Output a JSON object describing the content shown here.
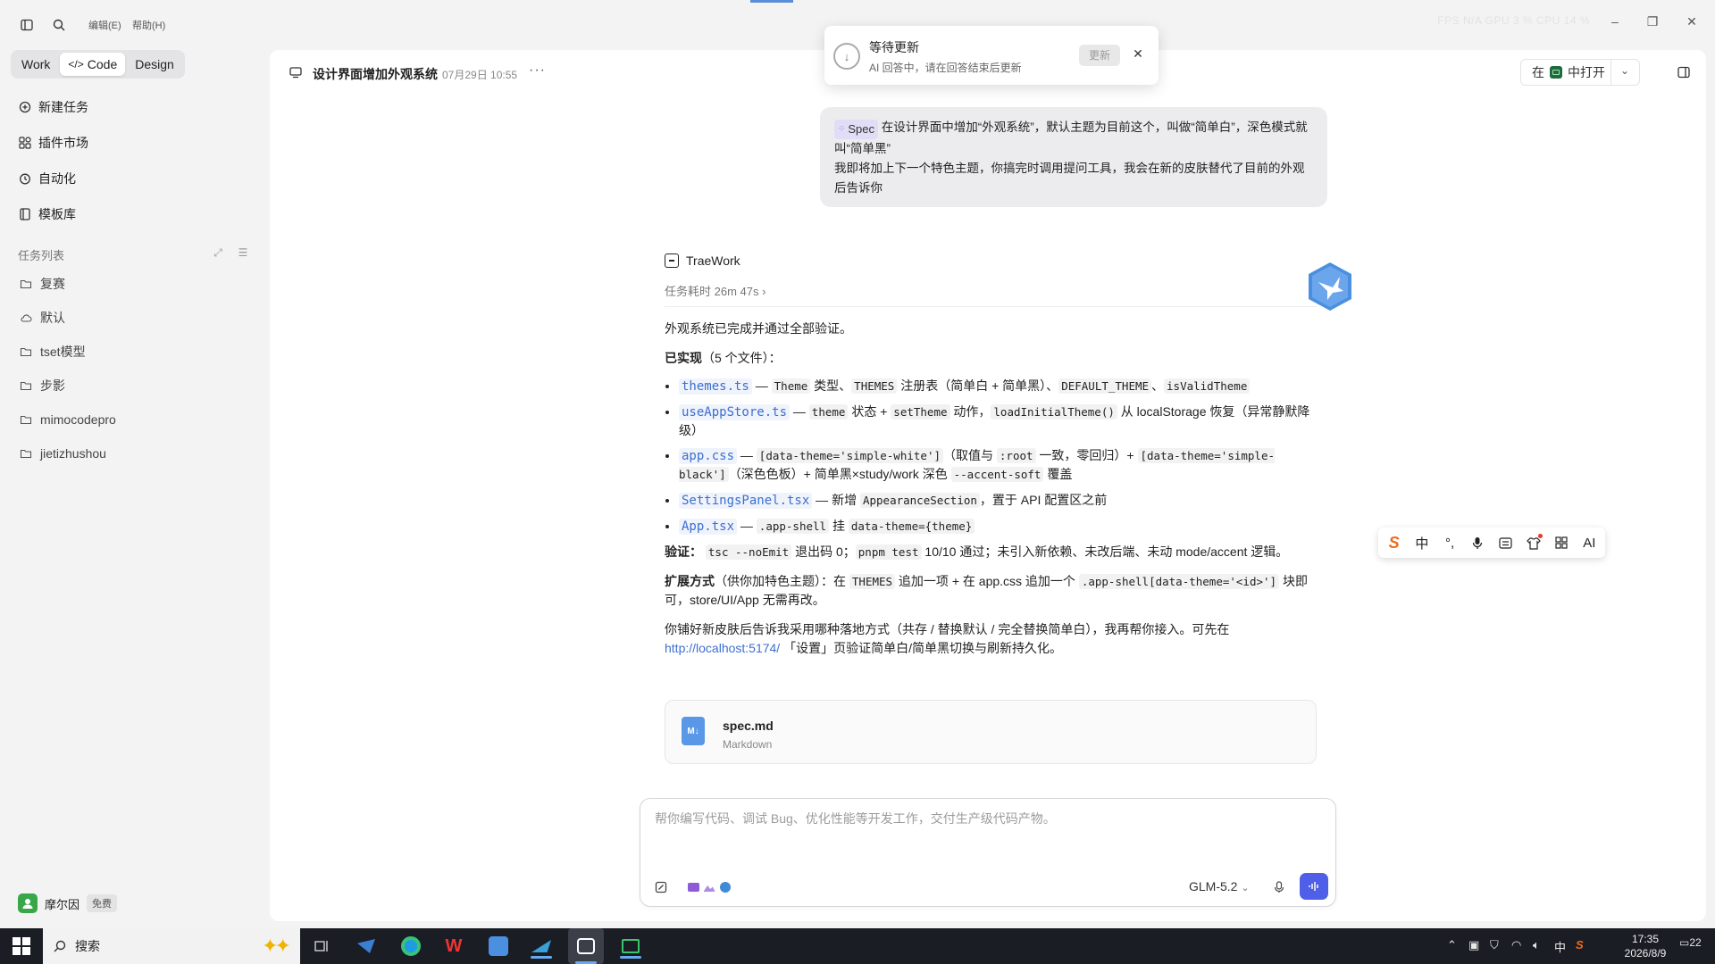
{
  "titlebar": {
    "menu_edit": "编辑(E)",
    "menu_help": "帮助(H)",
    "stats": "FPS N/A   GPU 3 %   CPU 14 %"
  },
  "sidebar": {
    "modes": [
      "Work",
      "Code",
      "Design"
    ],
    "active_mode": "Code",
    "nav": [
      {
        "label": "新建任务",
        "icon": "new-task-icon"
      },
      {
        "label": "插件市场",
        "icon": "plugins-icon"
      },
      {
        "label": "自动化",
        "icon": "clock-icon"
      },
      {
        "label": "模板库",
        "icon": "template-icon"
      }
    ],
    "section_label": "任务列表",
    "folders": [
      {
        "label": "复赛",
        "icon": "folder-icon"
      },
      {
        "label": "默认",
        "icon": "cloud-icon"
      },
      {
        "label": "tset模型",
        "icon": "folder-icon"
      },
      {
        "label": "步影",
        "icon": "folder-icon"
      },
      {
        "label": "mimocodepro",
        "icon": "folder-icon"
      },
      {
        "label": "jietizhushou",
        "icon": "folder-icon"
      }
    ],
    "user_name": "摩尔因",
    "user_plan": "免费",
    "update_label": "更新"
  },
  "header": {
    "task_title": "设计界面增加外观系统",
    "task_date": "07月29日 10:55",
    "open_in_prefix": "在",
    "open_in_label": "中打开"
  },
  "toast": {
    "title": "等待更新",
    "subtitle": "AI 回答中，请在回答结束后更新",
    "button": "更新"
  },
  "user_message": {
    "tag": "Spec",
    "line1": "在设计界面中增加“外观系统”，默认主题为目前这个，叫做“简单白”，深色模式就叫“简单黑”",
    "line2": "我即将加上下一个特色主题，你搞完时调用提问工具，我会在新的皮肤替代了目前的外观后告诉你"
  },
  "assistant": {
    "name": "TraeWork",
    "elapsed": "任务耗时 26m 47s",
    "intro": "外观系统已完成并通过全部验证。",
    "implemented_label": "已实现",
    "implemented_count": "（5 个文件）：",
    "items": [
      {
        "file": "themes.ts",
        "desc_parts": [
          "Theme",
          " 类型、",
          "THEMES",
          " 注册表（简单白 + 简单黑）、",
          "DEFAULT_THEME",
          "、",
          "isValidTheme"
        ]
      },
      {
        "file": "useAppStore.ts",
        "desc_parts": [
          "theme",
          " 状态 + ",
          "setTheme",
          " 动作，",
          "loadInitialTheme()",
          " 从 localStorage 恢复（异常静默降级）"
        ]
      },
      {
        "file": "app.css",
        "desc_parts": [
          "[data-theme='simple-white']",
          "（取值与 ",
          ":root",
          " 一致，零回归）+ ",
          "[data-theme='simple-black']",
          "（深色色板）+ 简单黑×study/work 深色 ",
          "--accent-soft",
          " 覆盖"
        ]
      },
      {
        "file": "SettingsPanel.tsx",
        "desc_parts": [
          "新增 ",
          "AppearanceSection",
          "，置于 API 配置区之前"
        ]
      },
      {
        "file": "App.tsx",
        "desc_parts": [
          ".app-shell",
          " 挂 ",
          "data-theme={theme}"
        ]
      }
    ],
    "verify_label": "验证：",
    "verify_parts": [
      "tsc --noEmit",
      " 退出码 0；",
      "pnpm test",
      " 10/10 通过；未引入新依赖、未改后端、未动 mode/accent 逻辑。"
    ],
    "extend_label": "扩展方式",
    "extend_parts": [
      "（供你加特色主题）：在 ",
      "THEMES",
      " 追加一项 + 在 app.css 追加一个 ",
      ".app-shell[data-theme='<id>']",
      " 块即可，store/UI/App 无需再改。"
    ],
    "closing_before": "你铺好新皮肤后告诉我采用哪种落地方式（共存 / 替换默认 / 完全替换简单白），我再帮你接入。可先在",
    "closing_url": "http://localhost:5174/",
    "closing_after": "「设置」页验证简单白/简单黑切换与刷新持久化。"
  },
  "file_card": {
    "name": "spec.md",
    "type": "Markdown",
    "icon_text": "M↓"
  },
  "composer": {
    "placeholder": "帮你编写代码、调试 Bug、优化性能等开发工作，交付生产级代码产物。",
    "model": "GLM-5.2"
  },
  "ime": {
    "items": [
      "中",
      "°,",
      "AI"
    ]
  },
  "taskbar": {
    "search_label": "搜索",
    "tray_lang": "中",
    "time": "17:35",
    "date": "2026/8/9",
    "notification_count": "22"
  },
  "colors": {
    "accent": "#4f5fe8",
    "link": "#3c6fd1",
    "taskbar": "#1a1d24"
  }
}
